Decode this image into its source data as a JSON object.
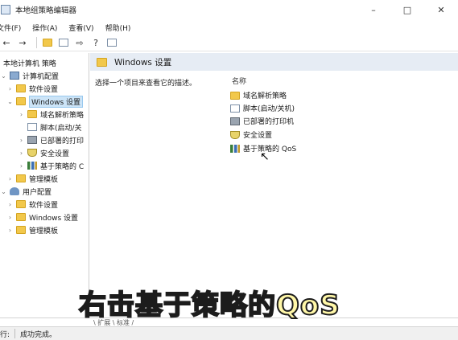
{
  "window": {
    "title": "本地组策略编辑器",
    "controls": [
      "–",
      "□",
      "✕"
    ]
  },
  "menu": [
    "文件(F)",
    "操作(A)",
    "查看(V)",
    "帮助(H)"
  ],
  "toolbar": [
    "back-icon",
    "forward-icon",
    "up-folder-icon",
    "show-hide-tree-icon",
    "export-icon",
    "help-icon",
    "properties-icon"
  ],
  "tree": {
    "items": [
      {
        "label": "本地计算机 策略",
        "icon": "computer-policy-icon",
        "expander": ""
      },
      {
        "label": "计算机配置",
        "icon": "computer-icon",
        "expander": "⌄"
      },
      {
        "label": "软件设置",
        "icon": "folder-icon",
        "expander": "›"
      },
      {
        "label": "Windows 设置",
        "icon": "folder-icon",
        "expander": "⌄",
        "selected": true
      },
      {
        "label": "域名解析策略",
        "icon": "folder-icon",
        "expander": "›"
      },
      {
        "label": "脚本(启动/关",
        "icon": "script-icon",
        "expander": ""
      },
      {
        "label": "已部署的打印",
        "icon": "printer-icon",
        "expander": "›"
      },
      {
        "label": "安全设置",
        "icon": "security-icon",
        "expander": "›"
      },
      {
        "label": "基于策略的 C",
        "icon": "qos-icon",
        "expander": "›"
      },
      {
        "label": "管理模板",
        "icon": "folder-icon",
        "expander": "›"
      },
      {
        "label": "用户配置",
        "icon": "user-icon",
        "expander": "⌄"
      },
      {
        "label": "软件设置",
        "icon": "folder-icon",
        "expander": "›"
      },
      {
        "label": "Windows 设置",
        "icon": "folder-icon",
        "expander": "›"
      },
      {
        "label": "管理模板",
        "icon": "folder-icon",
        "expander": "›"
      }
    ]
  },
  "content": {
    "header": "Windows 设置",
    "description": "选择一个项目来查看它的描述。",
    "column_name": "名称",
    "items": [
      {
        "label": "域名解析策略",
        "icon": "folder-icon"
      },
      {
        "label": "脚本(启动/关机)",
        "icon": "script-icon"
      },
      {
        "label": "已部署的打印机",
        "icon": "printer-icon"
      },
      {
        "label": "安全设置",
        "icon": "security-icon"
      },
      {
        "label": "基于策略的 QoS",
        "icon": "qos-icon"
      }
    ]
  },
  "bottom_tabs": "\\ 扩展 \\ 标准 /",
  "status": {
    "prefix": "行:",
    "text": "成功完成。"
  },
  "caption": "右击基于策略的QoS"
}
